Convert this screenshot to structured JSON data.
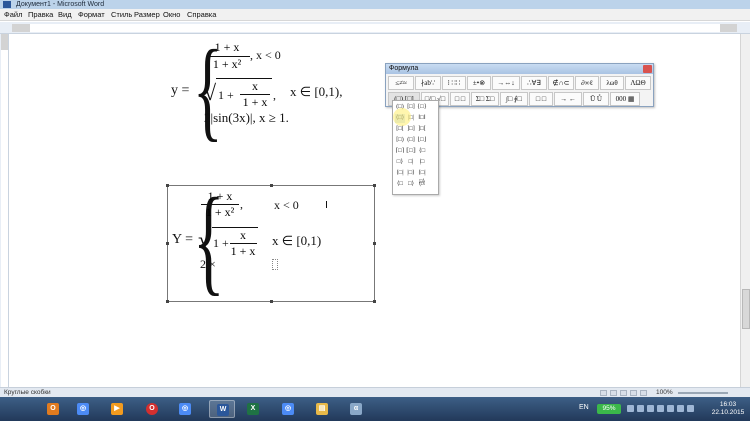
{
  "window": {
    "title": "Документ1 - Microsoft Word"
  },
  "menu": {
    "items": [
      "Файл",
      "Правка",
      "Вид",
      "Формат",
      "Стиль",
      "Размер",
      "Окно",
      "Справка"
    ]
  },
  "document": {
    "formula1": {
      "lhs": "y =",
      "case1_num": "1 + x",
      "case1_den": "1 + x²",
      "case1_cond": ", x < 0",
      "case2_sqrt_a": "1 +",
      "case2_frac_num": "x",
      "case2_frac_den": "1 + x",
      "case2_tail": ",",
      "case2_cond": "x ∈ [0,1),",
      "case3": "2|sin(3x)|, x ≥ 1."
    },
    "formula2": {
      "lhs": "Y =",
      "case1_num": "1 + x",
      "case1_den": "1 + x²",
      "case1_tail": ",",
      "case1_cond": "x < 0",
      "case2_sqrt_a": "1 +",
      "case2_frac_num": "x",
      "case2_frac_den": "1 + x",
      "case2_cond": "x ∈ [0,1)",
      "case3": "2 ×"
    }
  },
  "equation_toolbar": {
    "title": "Формула",
    "row1": [
      "≤≠≈",
      "∤ab∵",
      "⁞ ∷∷",
      "±•⊗",
      "→⇔↓",
      "∴∀∃",
      "∉∩⊂",
      "∂∞ℓ",
      "λωθ",
      "ΛΩΘ"
    ],
    "row2": [
      "(□) [□]",
      "□/□ √□",
      "□ □",
      "Σ□ Σ□",
      "∫□ ∮□",
      "□ □",
      "→ ←",
      "Ū Ů",
      "000 ▦"
    ],
    "dropdown_cells": [
      "(□)",
      "[□]",
      "{□}",
      "⟨□⟩",
      "|□|",
      "‖□‖",
      "[□[",
      "]□]",
      "]□[",
      "[□)",
      "(□]",
      "⌊□⌋",
      "⌈□⌉",
      "⟦□⟧",
      "{□",
      "□}",
      "□|",
      "|□",
      "⟨□|",
      "|□⟩",
      "⟨□|□⟩",
      "⟨□",
      "□⟩",
      "(□"
    ]
  },
  "status_bar": {
    "text": "Круглые скобки",
    "zoom": "100%"
  },
  "taskbar": {
    "apps": [
      {
        "name": "outlook",
        "glyph": "O",
        "color": "#e07b1f"
      },
      {
        "name": "chrome",
        "glyph": "◎",
        "color": "#4c8bf5"
      },
      {
        "name": "media-player",
        "glyph": "▶",
        "color": "#f29b1f"
      },
      {
        "name": "opera",
        "glyph": "O",
        "color": "#d32f2f"
      },
      {
        "name": "chrome2",
        "glyph": "◎",
        "color": "#4c8bf5"
      },
      {
        "name": "word",
        "glyph": "W",
        "color": "#2b579a"
      },
      {
        "name": "excel",
        "glyph": "X",
        "color": "#1f7244"
      },
      {
        "name": "chrome3",
        "glyph": "◎",
        "color": "#4c8bf5"
      },
      {
        "name": "file-explorer",
        "glyph": "▤",
        "color": "#e8b949"
      },
      {
        "name": "photos",
        "glyph": "▣",
        "color": "#6aa0d8"
      },
      {
        "name": "mathcad",
        "glyph": "α",
        "color": "#8aa8c8"
      }
    ],
    "tray": {
      "language": "EN",
      "battery": "95%",
      "time": "16:03",
      "date": "22.10.2015"
    }
  }
}
